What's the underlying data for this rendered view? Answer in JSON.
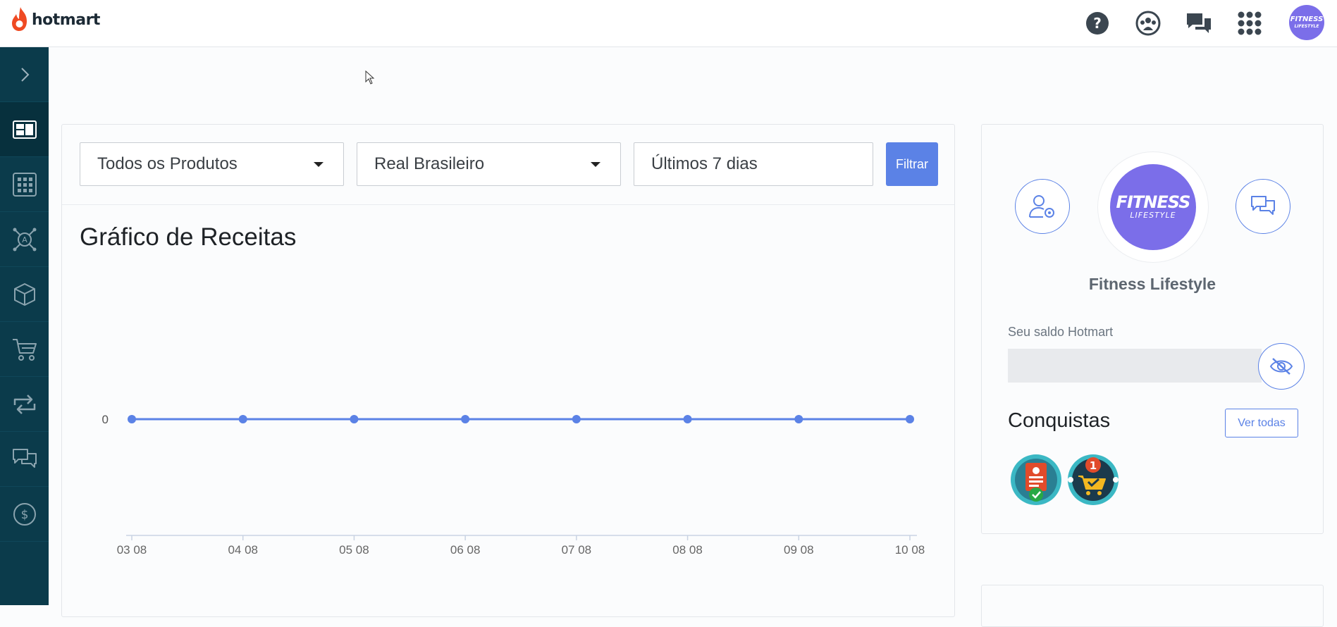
{
  "brand": {
    "name": "hotmart",
    "flame_color": "#ef4a23"
  },
  "topbar": {
    "icons": [
      "help-icon",
      "community-icon",
      "chat-icon",
      "apps-grid-icon"
    ],
    "avatar_text_1": "FITNESS",
    "avatar_text_2": "LIFESTYLE"
  },
  "sidebar": {
    "items": [
      "expand-chevron-icon",
      "dashboard-icon",
      "apps-icon",
      "affiliate-network-icon",
      "product-box-icon",
      "cart-icon",
      "recurrence-icon",
      "messages-icon",
      "finance-icon"
    ]
  },
  "filters": {
    "product": "Todos os Produtos",
    "currency": "Real Brasileiro",
    "period": "Últimos 7 dias",
    "filter_button": "Filtrar"
  },
  "chart_data": {
    "type": "line",
    "title": "Gráfico de Receitas",
    "categories": [
      "03 08",
      "04 08",
      "05 08",
      "06 08",
      "07 08",
      "08 08",
      "09 08",
      "10 08"
    ],
    "series": [
      {
        "values": [
          0,
          0,
          0,
          0,
          0,
          0,
          0,
          0
        ]
      }
    ],
    "y_ticks": [
      "0"
    ],
    "color": "#5b82e6",
    "grid": false,
    "legend": "none"
  },
  "profile": {
    "avatar_text_1": "FITNESS",
    "avatar_text_2": "LIFESTYLE",
    "name": "Fitness Lifestyle",
    "balance_label": "Seu saldo Hotmart"
  },
  "achievements": {
    "title": "Conquistas",
    "see_all": "Ver todas",
    "badges": [
      "profile-complete-badge-icon",
      "first-sale-badge-icon"
    ]
  },
  "accent": "#5b82e6",
  "sidebar_color": "#0b3b4b"
}
